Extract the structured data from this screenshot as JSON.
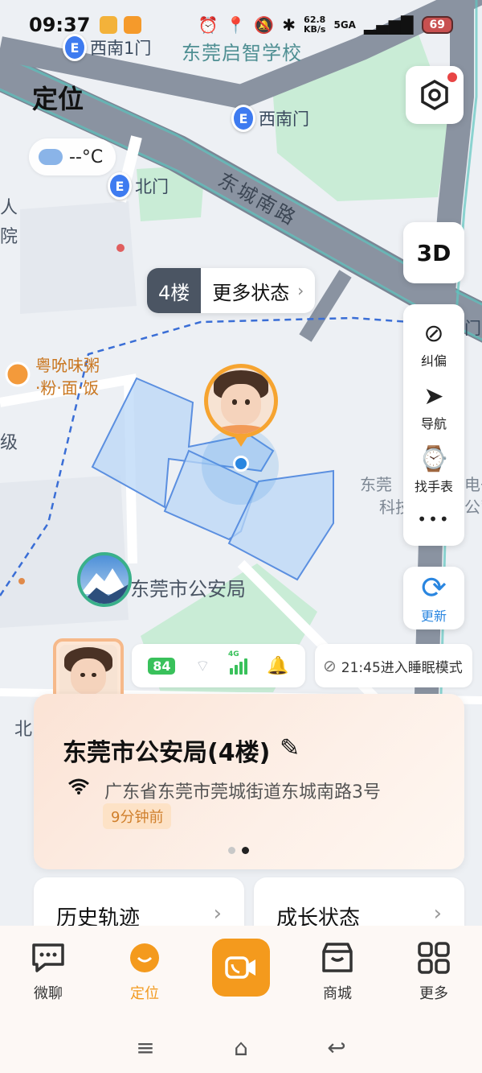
{
  "status_bar": {
    "time": "09:37",
    "net_speed_value": "62.8",
    "net_speed_unit": "KB/s",
    "network": "5GA",
    "battery": "69",
    "icons": [
      "alarm-icon",
      "location-icon",
      "mute-icon",
      "bluetooth-icon",
      "signal-icon"
    ]
  },
  "header": {
    "title": "定位"
  },
  "weather": {
    "temp": "--°C",
    "icon": "cloud-icon"
  },
  "map": {
    "labels": {
      "school": "东莞启智学校",
      "road": "东城南路",
      "police": "东莞市公安局",
      "restaurant_line1": "粤吮味粥",
      "restaurant_line2": "·粉·面·饭",
      "left_edge_1": "人",
      "left_edge_2": "院",
      "left_edge_3": "级",
      "right_edge_1": "东莞",
      "right_edge_2": "科技",
      "right_edge_3": "电子",
      "right_edge_4": "公司",
      "bottom_left": "北"
    },
    "pois": {
      "gate_southwest_1": "西南1门",
      "gate_southwest": "西南门",
      "gate_north": "北门",
      "right_gate": "门"
    }
  },
  "controls": {
    "three_d": "3D",
    "tools": [
      {
        "label": "纠偏",
        "icon": "correct-icon"
      },
      {
        "label": "导航",
        "icon": "navigate-icon"
      },
      {
        "label": "找手表",
        "icon": "find-watch-icon"
      }
    ],
    "more_dots": "•••",
    "refresh": "更新"
  },
  "floor_chip": {
    "floor": "4楼",
    "more": "更多状态"
  },
  "device": {
    "battery": "84",
    "network_tag": "4G",
    "sleep_text": "21:45进入睡眠模式"
  },
  "location_card": {
    "name": "东莞市公安局(4楼)",
    "address": "广东省东莞市莞城街道东城南路3号",
    "time_ago": "9分钟前"
  },
  "features": [
    {
      "label": "历史轨迹"
    },
    {
      "label": "成长状态"
    }
  ],
  "nav": {
    "items": [
      {
        "label": "微聊",
        "icon": "chat-icon"
      },
      {
        "label": "定位",
        "icon": "location-face-icon",
        "active": true
      },
      {
        "label": "",
        "icon": "video-call-icon"
      },
      {
        "label": "商城",
        "icon": "store-icon"
      },
      {
        "label": "更多",
        "icon": "grid-icon"
      }
    ]
  },
  "colors": {
    "accent": "#f49a1d",
    "blue": "#2a86e0",
    "battery_green": "#39c15b"
  }
}
